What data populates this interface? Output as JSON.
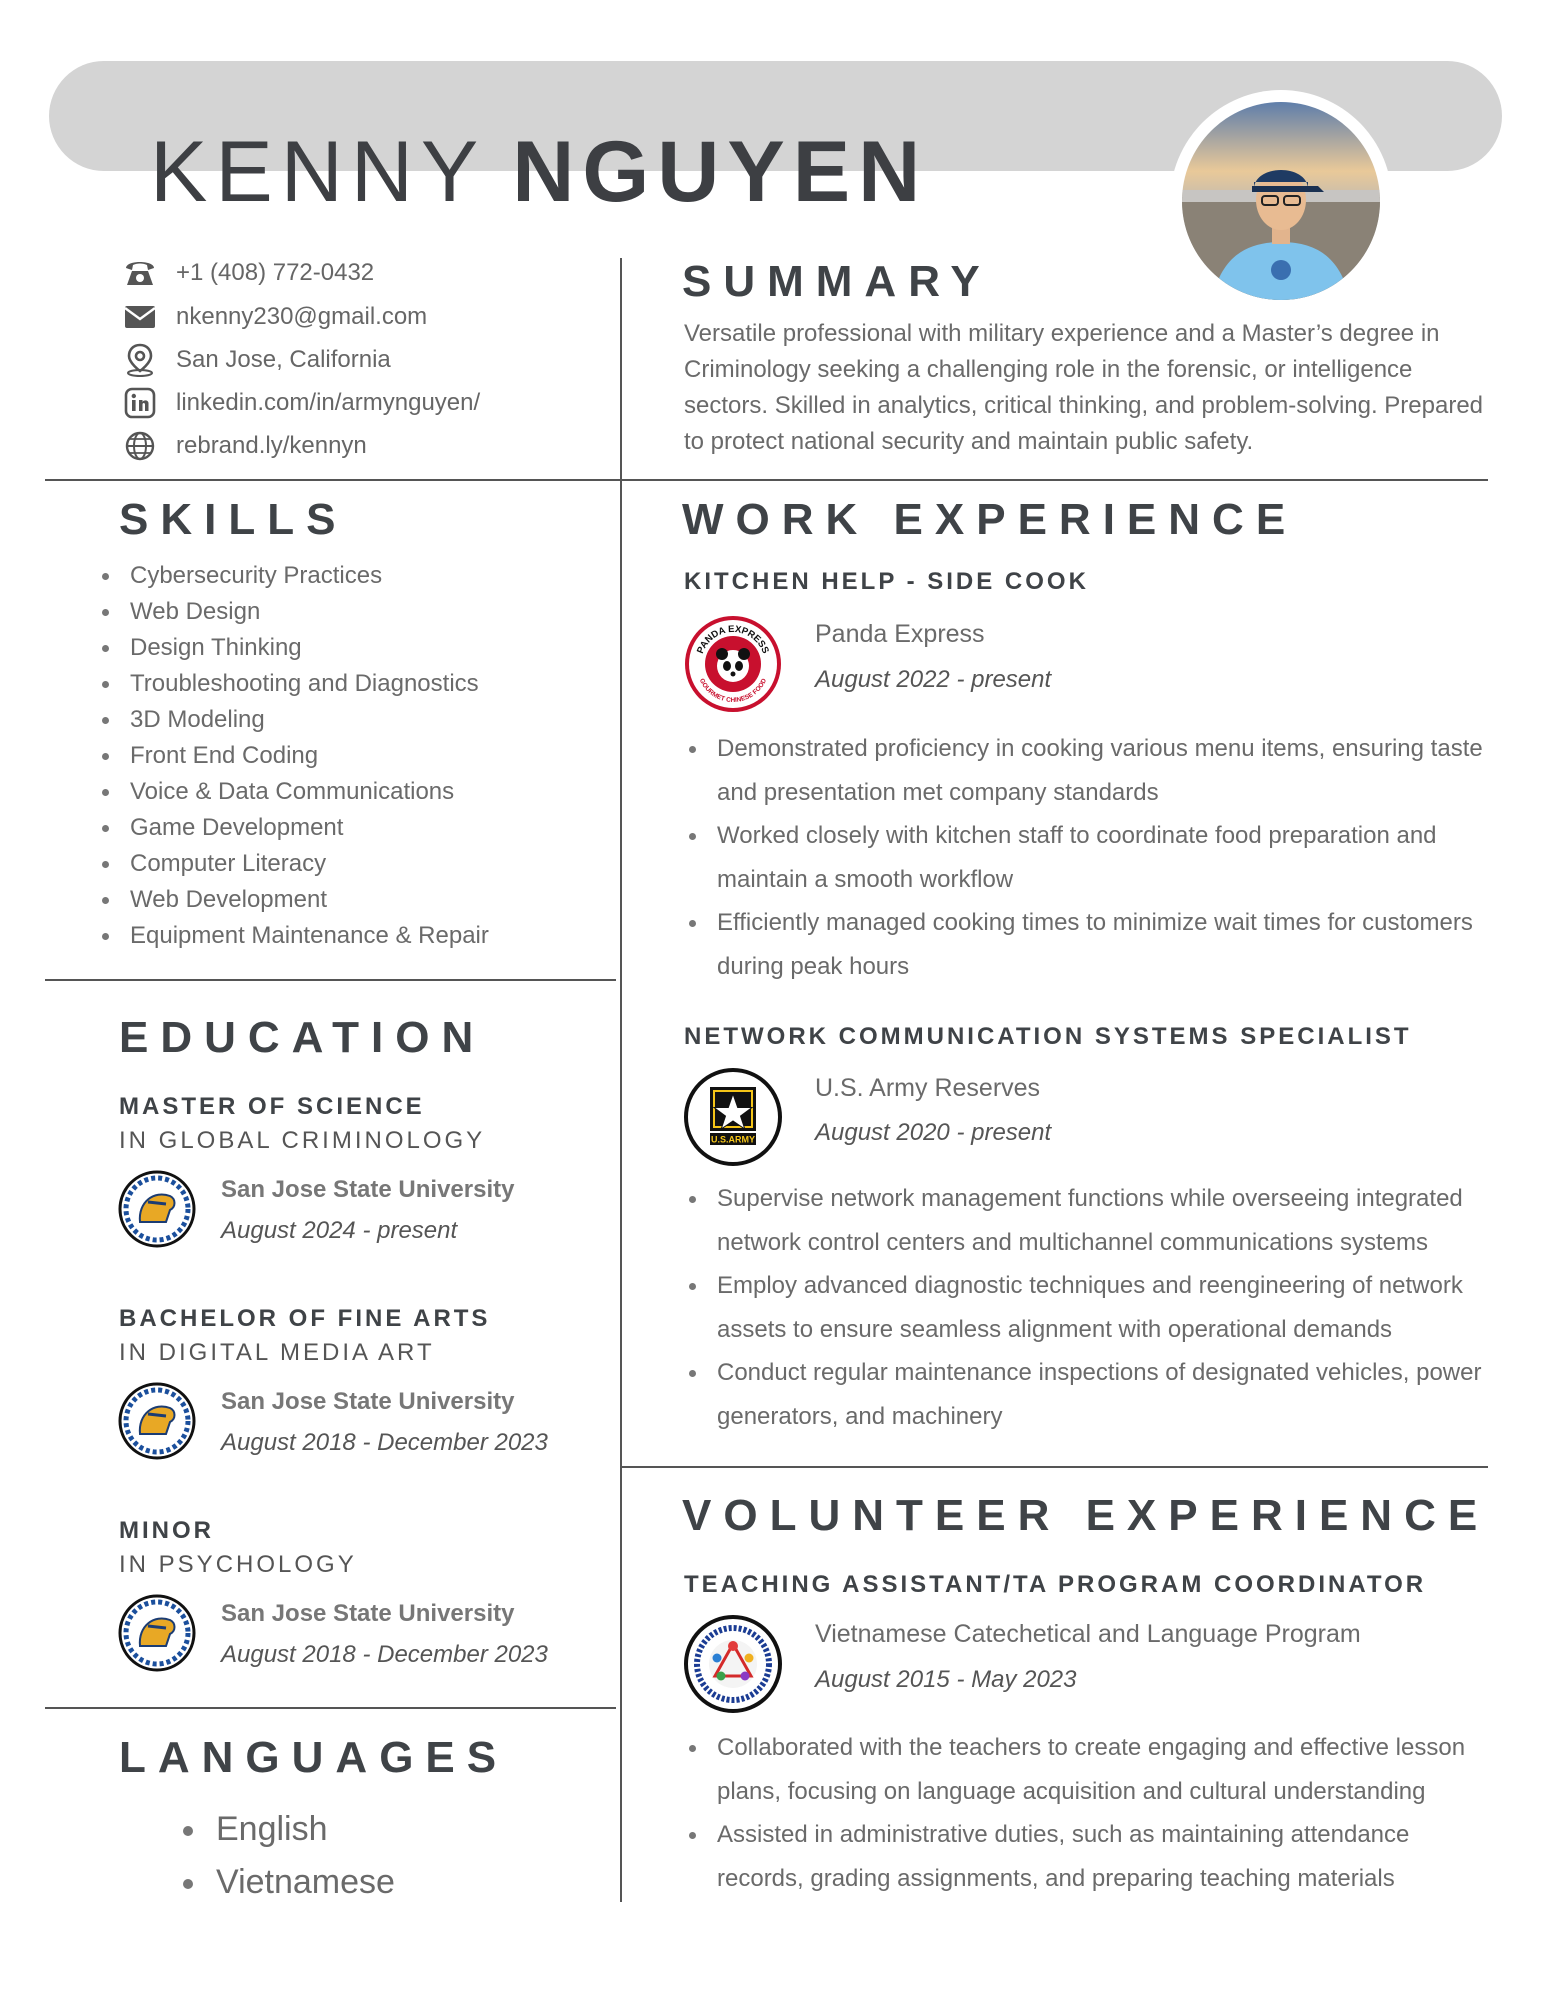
{
  "header": {
    "first_name": "KENNY",
    "last_name": "NGUYEN"
  },
  "contact": {
    "phone": "+1 (408) 772-0432",
    "email": "nkenny230@gmail.com",
    "location": "San Jose, California",
    "linkedin": "linkedin.com/in/armynguyen/",
    "website": "rebrand.ly/kennyn"
  },
  "summary": {
    "title": "SUMMARY",
    "text": "Versatile professional with military experience and a Master’s degree in Criminology seeking a challenging role in the forensic, or intelligence sectors. Skilled in analytics, critical thinking, and problem-solving. Prepared to protect national security and maintain public safety."
  },
  "skills": {
    "title": "SKILLS",
    "items": [
      "Cybersecurity Practices",
      "Web Design",
      "Design Thinking",
      "Troubleshooting and Diagnostics",
      "3D Modeling",
      "Front End Coding",
      "Voice & Data Communications",
      "Game Development",
      "Computer Literacy",
      "Web Development",
      "Equipment Maintenance & Repair"
    ]
  },
  "education": {
    "title": "EDUCATION",
    "entries": [
      {
        "degree": "MASTER OF SCIENCE",
        "field": "IN GLOBAL CRIMINOLOGY",
        "school": "San Jose State University",
        "dates": "August 2024 - present"
      },
      {
        "degree": "BACHELOR OF FINE ARTS",
        "field": "IN DIGITAL MEDIA ART",
        "school": "San Jose State University",
        "dates": "August 2018 - December 2023"
      },
      {
        "degree": "MINOR",
        "field": "IN PSYCHOLOGY",
        "school": "San Jose State University",
        "dates": "August 2018 - December 2023"
      }
    ]
  },
  "languages": {
    "title": "LANGUAGES",
    "items": [
      "English",
      "Vietnamese"
    ]
  },
  "work": {
    "title": "WORK EXPERIENCE",
    "jobs": [
      {
        "title": "KITCHEN HELP - SIDE COOK",
        "org": "Panda Express",
        "dates": "August 2022 - present",
        "bullets": [
          "Demonstrated proficiency in cooking various menu items, ensuring taste and presentation met company standards",
          "Worked closely with kitchen staff to coordinate food preparation and maintain a smooth workflow",
          "Efficiently managed cooking times to minimize wait times for customers during peak hours"
        ]
      },
      {
        "title": "NETWORK COMMUNICATION SYSTEMS SPECIALIST",
        "org": "U.S. Army Reserves",
        "dates": "August 2020 - present",
        "bullets": [
          "Supervise network management functions while overseeing integrated network control centers and multichannel communications systems",
          "Employ advanced diagnostic techniques and reengineering of network assets to ensure seamless alignment with operational demands",
          "Conduct regular maintenance inspections of designated vehicles, power generators, and machinery"
        ]
      }
    ]
  },
  "volunteer": {
    "title": "VOLUNTEER EXPERIENCE",
    "role": {
      "title": "TEACHING ASSISTANT/TA PROGRAM COORDINATOR",
      "org": "Vietnamese Catechetical and Language Program",
      "dates": "August 2015 - May 2023",
      "bullets": [
        "Collaborated with the teachers to create engaging and effective lesson plans, focusing on language acquisition and cultural understanding",
        "Assisted in administrative duties, such as maintaining attendance records, grading assignments, and preparing teaching materials"
      ]
    }
  },
  "logos": {
    "panda": {
      "ring_top": "PANDA EXPRESS",
      "ring_bottom": "GOURMET CHINESE FOOD"
    },
    "army": {
      "label": "U.S.ARMY"
    }
  },
  "icons": {
    "phone": "phone-icon",
    "email": "envelope-icon",
    "location": "map-pin-icon",
    "linkedin": "linkedin-icon",
    "website": "globe-icon"
  },
  "colors": {
    "heading": "#3f4347",
    "body_text": "#6a6a6a",
    "banner": "#d4d4d4",
    "rule": "#555555"
  }
}
